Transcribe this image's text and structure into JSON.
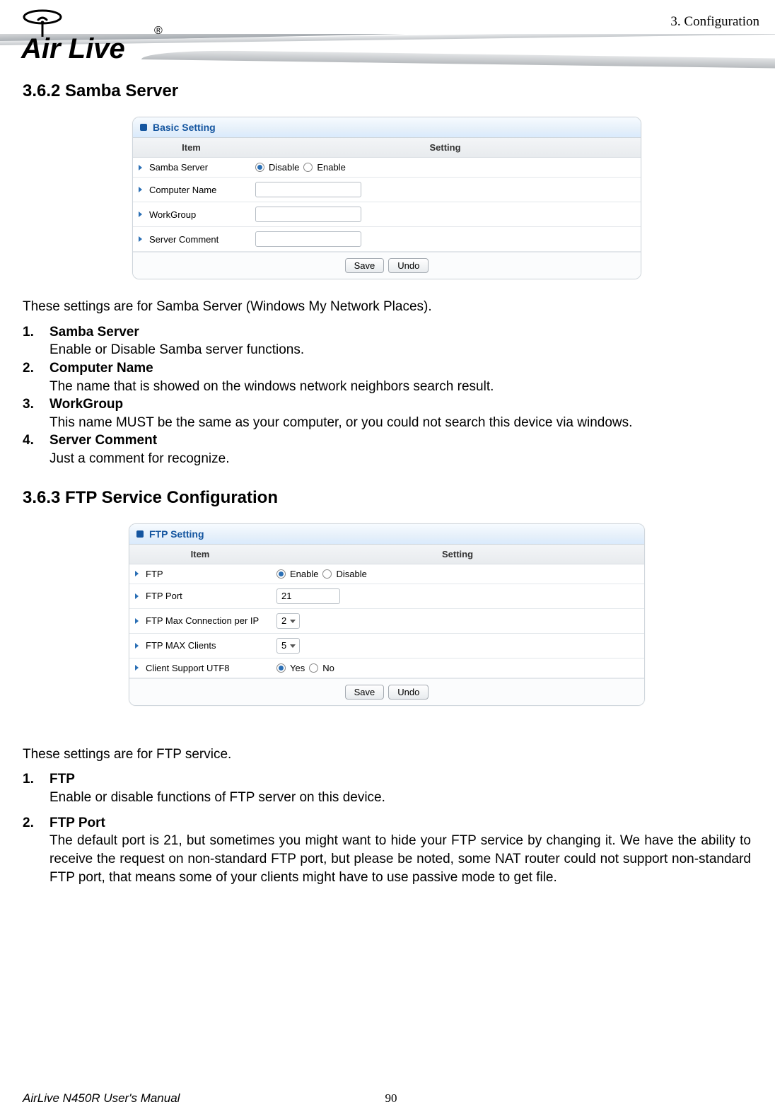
{
  "header": {
    "corner": "3.  Configuration",
    "logo_text": "Air Live",
    "logo_r": "®"
  },
  "samba": {
    "heading": "3.6.2 Samba Server",
    "panel_title": "Basic Setting",
    "cols": [
      "Item",
      "Setting"
    ],
    "rows": {
      "server_label": "Samba Server",
      "server_opts": {
        "disable": "Disable",
        "enable": "Enable",
        "selected": "disable"
      },
      "computer_label": "Computer Name",
      "computer_val": "",
      "workgroup_label": "WorkGroup",
      "workgroup_val": "",
      "comment_label": "Server Comment",
      "comment_val": ""
    },
    "buttons": {
      "save": "Save",
      "undo": "Undo"
    },
    "intro": "These settings are for Samba Server (Windows My Network Places).",
    "list": [
      {
        "n": "1.",
        "t": "Samba Server",
        "b": "Enable or Disable Samba server functions."
      },
      {
        "n": "2.",
        "t": "Computer Name",
        "b": "The name that is showed on the windows network neighbors search result."
      },
      {
        "n": "3.",
        "t": "WorkGroup",
        "b": "This name MUST be the same as your computer, or you could not search this device via windows."
      },
      {
        "n": "4.",
        "t": "Server Comment",
        "b": "Just a comment for recognize."
      }
    ]
  },
  "ftp": {
    "heading": "3.6.3 FTP Service Configuration",
    "panel_title": "FTP Setting",
    "cols": [
      "Item",
      "Setting"
    ],
    "rows": {
      "ftp_label": "FTP",
      "ftp_opts": {
        "enable": "Enable",
        "disable": "Disable",
        "selected": "enable"
      },
      "port_label": "FTP Port",
      "port_val": "21",
      "maxip_label": "FTP Max Connection per IP",
      "maxip_val": "2",
      "maxcl_label": "FTP MAX Clients",
      "maxcl_val": "5",
      "utf8_label": "Client Support UTF8",
      "utf8_opts": {
        "yes": "Yes",
        "no": "No",
        "selected": "yes"
      }
    },
    "buttons": {
      "save": "Save",
      "undo": "Undo"
    },
    "intro": "These settings are for FTP service.",
    "list": [
      {
        "n": "1.",
        "t": "FTP",
        "b": "Enable or disable functions of FTP server on this device."
      },
      {
        "n": "2.",
        "t": "FTP Port",
        "b": "The default port is 21, but sometimes you might want to hide your FTP service by changing it. We have the ability to receive the request on non-standard FTP port, but please be noted, some NAT router could not support non-standard FTP port, that means some of your clients might have to use passive mode to get file."
      }
    ]
  },
  "footer": {
    "left": "AirLive N450R User's Manual",
    "page": "90"
  }
}
